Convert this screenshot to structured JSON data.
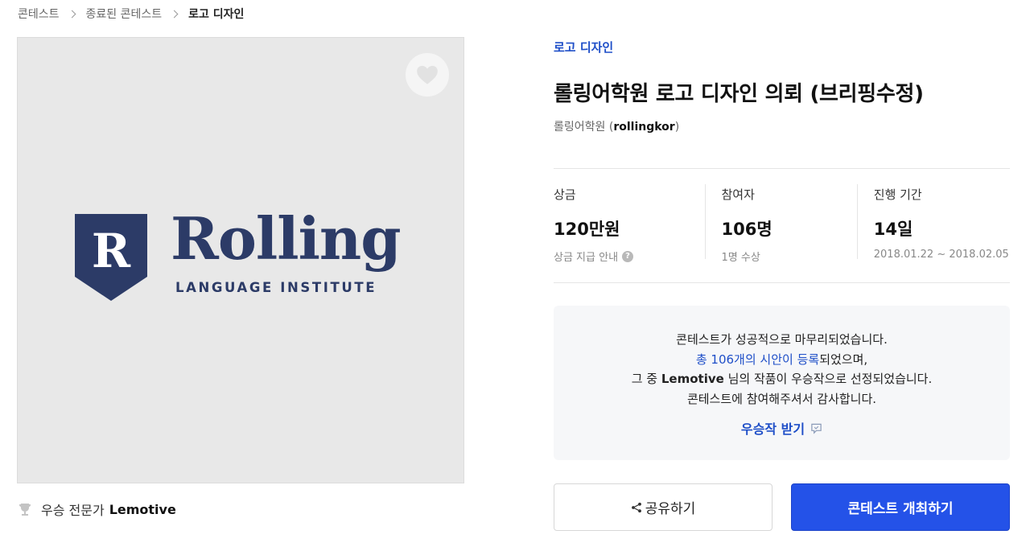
{
  "breadcrumb": {
    "items": [
      "콘테스트",
      "종료된 콘테스트",
      "로고 디자인"
    ]
  },
  "hero": {
    "logo_letter": "R",
    "logo_wordmark": "Rolling",
    "logo_subtitle": "LANGUAGE INSTITUTE",
    "like_icon": "heart-icon"
  },
  "winner": {
    "label": "우승 전문가",
    "name": "Lemotive",
    "icon": "trophy-icon"
  },
  "contest": {
    "category": "로고 디자인",
    "title": "롤링어학원 로고 디자인 의뢰 (브리핑수정)",
    "host_name": "롤링어학원",
    "host_id": "rollingkor"
  },
  "stats": [
    {
      "label": "상금",
      "value": "120만원",
      "note": "상금 지급 안내"
    },
    {
      "label": "참여자",
      "value": "106명",
      "note": "1명 수상"
    },
    {
      "label": "진행 기간",
      "value": "14일",
      "note": "2018.01.22 ~ 2018.02.05"
    }
  ],
  "notice": {
    "line1": "콘테스트가 성공적으로 마무리되었습니다.",
    "line2_highlight": "총 106개의 시안이 등록",
    "line2_rest": "되었으며,",
    "line3_pre": "그 중 ",
    "line3_name": "Lemotive",
    "line3_post": " 님의 작품이 우승작으로 선정되었습니다.",
    "line4": "콘테스트에 참여해주셔서 감사합니다.",
    "get_winner_label": "우승작 받기"
  },
  "buttons": {
    "share_label": "공유하기",
    "host_label": "콘테스트 개최하기"
  },
  "colors": {
    "accent": "#2452e8",
    "link": "#1f4fc8",
    "logo_navy": "#2c3b67"
  }
}
